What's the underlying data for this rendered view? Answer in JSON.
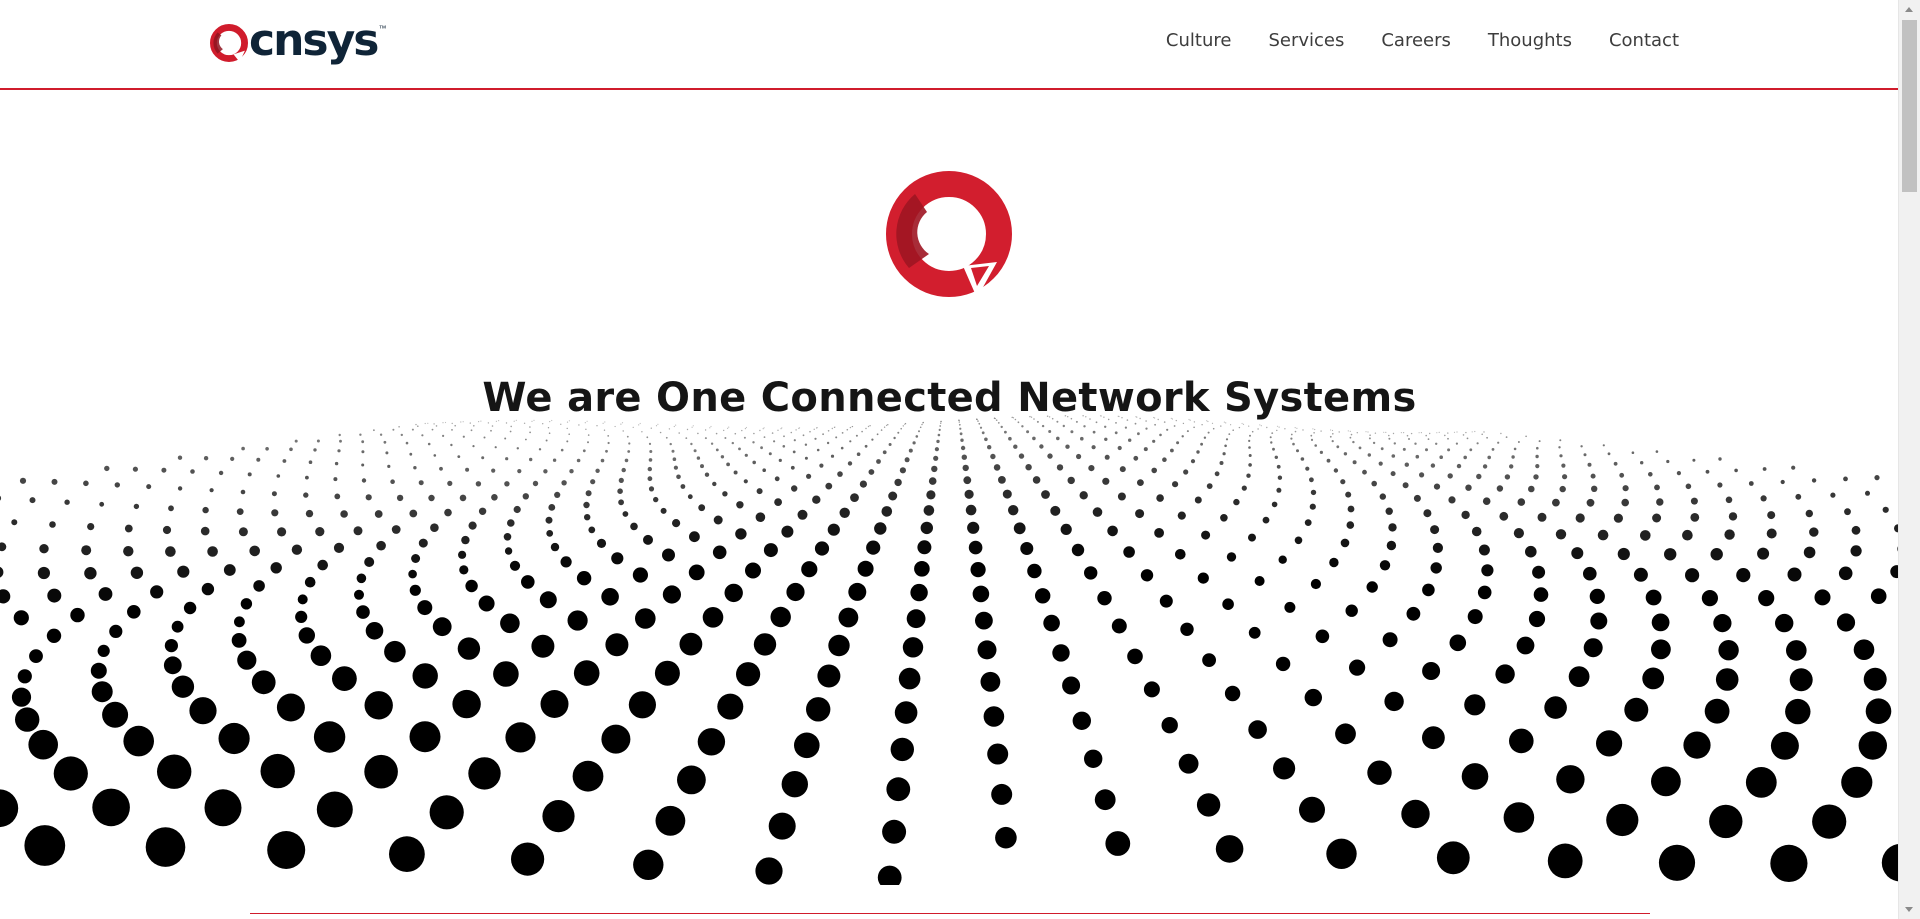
{
  "brand": {
    "name": "cnsys",
    "trademark": "™",
    "accent_color": "#d01c2c",
    "dark_accent_color": "#8f1420",
    "text_color": "#0f2437"
  },
  "nav": {
    "items": [
      {
        "label": "Culture"
      },
      {
        "label": "Services"
      },
      {
        "label": "Careers"
      },
      {
        "label": "Thoughts"
      },
      {
        "label": "Contact"
      }
    ]
  },
  "hero": {
    "title": "We are One Connected Network Systems",
    "icon": "ocnsys-ring-icon",
    "background": "dotted-wave-grid"
  },
  "scrollbar": {
    "position_percent": 0
  }
}
